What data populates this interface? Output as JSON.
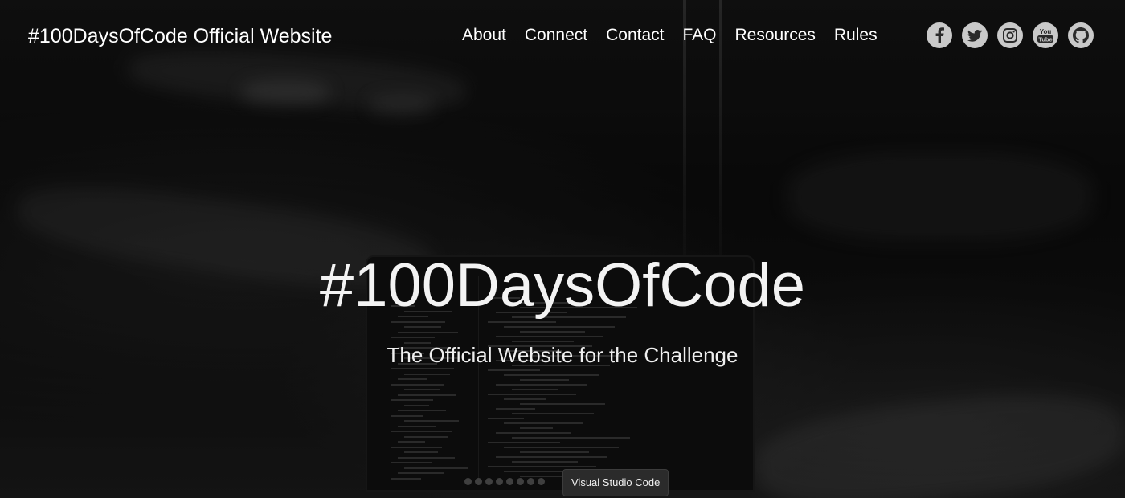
{
  "brand": "#100DaysOfCode Official Website",
  "nav": {
    "items": [
      {
        "label": "About"
      },
      {
        "label": "Connect"
      },
      {
        "label": "Contact"
      },
      {
        "label": "FAQ"
      },
      {
        "label": "Resources"
      },
      {
        "label": "Rules"
      }
    ]
  },
  "social": {
    "icons": [
      "facebook-icon",
      "twitter-icon",
      "instagram-icon",
      "youtube-icon",
      "github-icon"
    ],
    "youtube_text_top": "You",
    "youtube_text_bottom": "Tube"
  },
  "hero": {
    "title": "#100DaysOfCode",
    "subtitle": "The Official Website for the Challenge"
  },
  "tooltip": {
    "text": "Visual Studio Code"
  },
  "colors": {
    "icon_background": "#c9c9c9",
    "text": "#ffffff"
  }
}
